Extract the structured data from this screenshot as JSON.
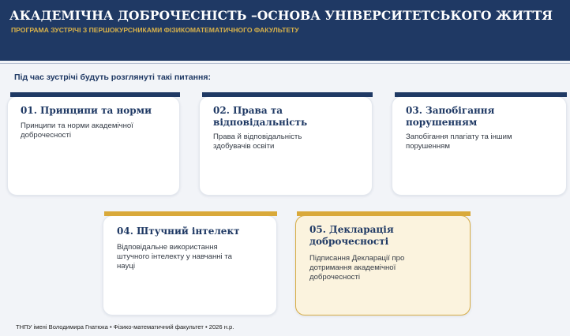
{
  "header": {
    "title": "АКАДЕМІЧНА ДОБРОЧЕСНІСТЬ –ОСНОВА УНІВЕРСИТЕТСЬКОГО ЖИТТЯ",
    "subtitle": "ПРОГРАМА ЗУСТРІЧІ З ПЕРШОКУРСНИКАМИ ФІЗИКОМАТЕМАТИЧНОГО ФАКУЛЬТЕТУ"
  },
  "intro": "Під час зустрічі будуть розглянуті такі питання:",
  "cards": [
    {
      "title_line1": "01. Принципи та норми",
      "title_line2": "",
      "text_line1": "Принципи та норми академічної",
      "text_line2": "доброчесності",
      "text_line3": ""
    },
    {
      "title_line1": "02. Права та",
      "title_line2": "відповідальність",
      "text_line1": "Права й відповідальність",
      "text_line2": "здобувачів освіти",
      "text_line3": ""
    },
    {
      "title_line1": "03. Запобігання",
      "title_line2": "порушенням",
      "text_line1": "Запобігання плагіату та іншим",
      "text_line2": "порушенням",
      "text_line3": ""
    },
    {
      "title_line1": "04. Штучний інтелект",
      "title_line2": "",
      "text_line1": "Відповідальне використання",
      "text_line2": "штучного інтелекту у навчанні та",
      "text_line3": "науці"
    },
    {
      "title_line1": "05. Декларація",
      "title_line2": "доброчесності",
      "text_line1": "Підписання Декларації про",
      "text_line2": "дотримання академічної",
      "text_line3": "доброчесності"
    }
  ],
  "footer": "ТНПУ імені Володимира Гнатюка • Фізико-математичний факультет • 2026 н.р.",
  "colors": {
    "navy": "#1f3964",
    "gold": "#d9a93a",
    "highlight_bg": "#fbf3de"
  }
}
